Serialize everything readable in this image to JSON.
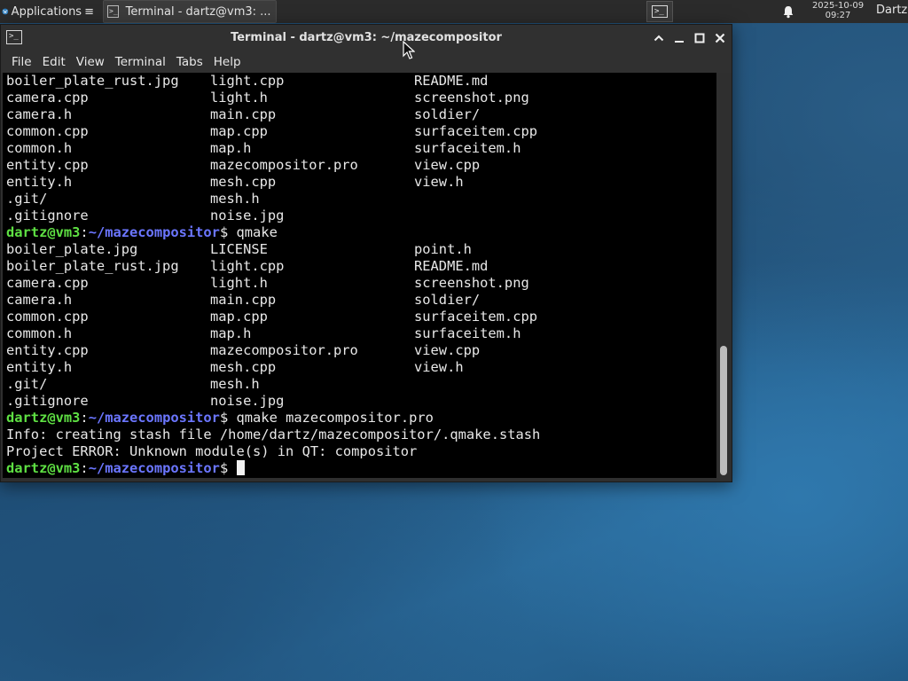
{
  "panel": {
    "applications_label": "Applications",
    "task_label": "Terminal - dartz@vm3: ...",
    "clock_date": "2025-10-09",
    "clock_time": "09:27",
    "user_label": "Dartz"
  },
  "window": {
    "title": "Terminal - dartz@vm3: ~/mazecompositor",
    "menu": [
      "File",
      "Edit",
      "View",
      "Terminal",
      "Tabs",
      "Help"
    ]
  },
  "terminal": {
    "prompt_user": "dartz@vm3",
    "prompt_colon": ":",
    "prompt_path": "~/mazecompositor",
    "prompt_dollar": "$",
    "listing_top": [
      [
        "boiler_plate_rust.jpg",
        "light.cpp",
        "README.md"
      ],
      [
        "camera.cpp",
        "light.h",
        "screenshot.png"
      ],
      [
        "camera.h",
        "main.cpp",
        "soldier/"
      ],
      [
        "common.cpp",
        "map.cpp",
        "surfaceitem.cpp"
      ],
      [
        "common.h",
        "map.h",
        "surfaceitem.h"
      ],
      [
        "entity.cpp",
        "mazecompositor.pro",
        "view.cpp"
      ],
      [
        "entity.h",
        "mesh.cpp",
        "view.h"
      ],
      [
        ".git/",
        "mesh.h",
        ""
      ],
      [
        ".gitignore",
        "noise.jpg",
        ""
      ]
    ],
    "command_1": " qmake",
    "listing_second": [
      [
        "boiler_plate.jpg",
        "LICENSE",
        "point.h"
      ],
      [
        "boiler_plate_rust.jpg",
        "light.cpp",
        "README.md"
      ],
      [
        "camera.cpp",
        "light.h",
        "screenshot.png"
      ],
      [
        "camera.h",
        "main.cpp",
        "soldier/"
      ],
      [
        "common.cpp",
        "map.cpp",
        "surfaceitem.cpp"
      ],
      [
        "common.h",
        "map.h",
        "surfaceitem.h"
      ],
      [
        "entity.cpp",
        "mazecompositor.pro",
        "view.cpp"
      ],
      [
        "entity.h",
        "mesh.cpp",
        "view.h"
      ],
      [
        ".git/",
        "mesh.h",
        ""
      ],
      [
        ".gitignore",
        "noise.jpg",
        ""
      ]
    ],
    "command_2": " qmake mazecompositor.pro",
    "output_info": "Info: creating stash file /home/dartz/mazecompositor/.qmake.stash",
    "output_error": "Project ERROR: Unknown module(s) in QT: compositor",
    "current_input": " "
  },
  "icons": {
    "applications": "xfce-logo-icon",
    "task": "terminal-icon",
    "launcher": "terminal-icon",
    "notifications": "bell-icon",
    "window": "terminal-icon",
    "maximize_left": "chevron-up-icon",
    "minimize": "minimize-icon",
    "maximize": "maximize-icon",
    "close": "close-icon",
    "pointer": "mouse-pointer-icon"
  },
  "colors": {
    "prompt_user": "#5ee043",
    "prompt_path": "#6b76ff",
    "terminal_bg": "#000000",
    "terminal_fg": "#e8e8e8"
  }
}
